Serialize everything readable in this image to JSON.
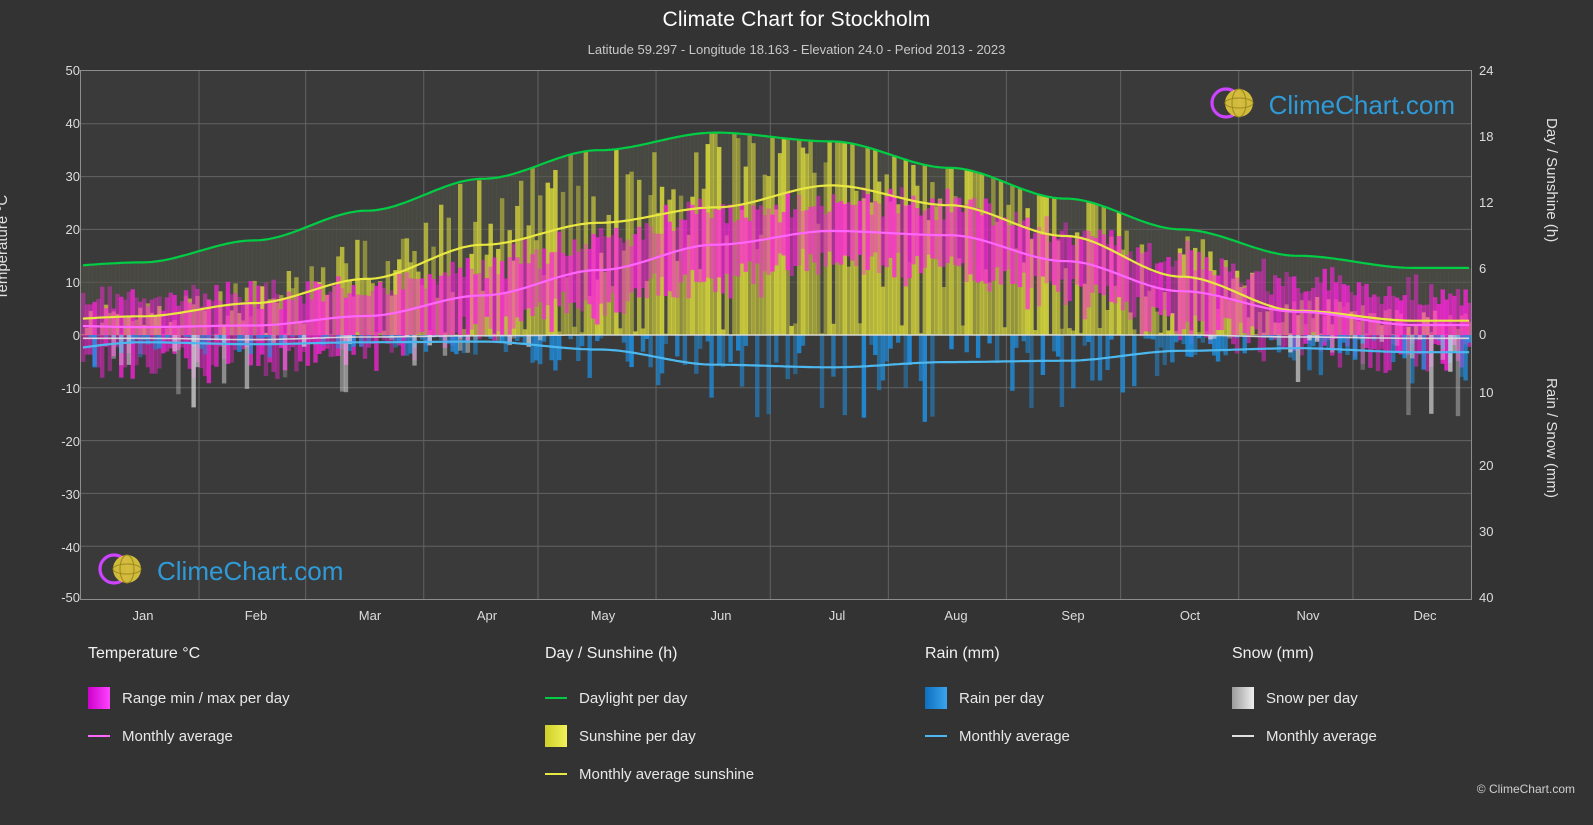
{
  "title": "Climate Chart for Stockholm",
  "subtitle": "Latitude 59.297 - Longitude 18.163 - Elevation 24.0 - Period 2013 - 2023",
  "axes": {
    "left_label": "Temperature °C",
    "right_label_top": "Day / Sunshine (h)",
    "right_label_bottom": "Rain / Snow (mm)",
    "left_ticks": [
      "50",
      "40",
      "30",
      "20",
      "10",
      "0",
      "-10",
      "-20",
      "-30",
      "-40",
      "-50"
    ],
    "right_ticks_top": [
      "24",
      "18",
      "12",
      "6",
      "0"
    ],
    "right_ticks_bottom": [
      "10",
      "20",
      "30",
      "40"
    ],
    "x_ticks": [
      "Jan",
      "Feb",
      "Mar",
      "Apr",
      "May",
      "Jun",
      "Jul",
      "Aug",
      "Sep",
      "Oct",
      "Nov",
      "Dec"
    ]
  },
  "legend": {
    "columns": [
      {
        "heading": "Temperature °C",
        "items": [
          {
            "label": "Range min / max per day",
            "type": "box",
            "color": "#ff00ff"
          },
          {
            "label": "Monthly average",
            "type": "line",
            "color": "#ff66ff"
          }
        ]
      },
      {
        "heading": "Day / Sunshine (h)",
        "items": [
          {
            "label": "Daylight per day",
            "type": "line",
            "color": "#00cc44"
          },
          {
            "label": "Sunshine per day",
            "type": "box",
            "color": "#e8e840"
          },
          {
            "label": "Monthly average sunshine",
            "type": "line",
            "color": "#e8e840"
          }
        ]
      },
      {
        "heading": "Rain (mm)",
        "items": [
          {
            "label": "Rain per day",
            "type": "box",
            "color": "#1f8fe0"
          },
          {
            "label": "Monthly average",
            "type": "line",
            "color": "#4db8f0"
          }
        ]
      },
      {
        "heading": "Snow (mm)",
        "items": [
          {
            "label": "Snow per day",
            "type": "box",
            "color": "#d8d8d8"
          },
          {
            "label": "Monthly average",
            "type": "line",
            "color": "#e0e0e0"
          }
        ]
      }
    ]
  },
  "copyright": "© ClimeChart.com",
  "watermark": {
    "brand_main": "Clime",
    "brand_rest": "Chart",
    "brand_tld": ".com"
  },
  "colors": {
    "background": "#333333",
    "plot_background": "#3a3a3a",
    "grid": "#6e6e6e",
    "daylight": "#00cc44",
    "sunshine": "#e8e840",
    "temp_range": "#ff00ff",
    "temp_avg": "#ff66ff",
    "rain": "#1f8fe0",
    "rain_avg": "#4db8f0",
    "snow": "#d8d8d8"
  },
  "chart_data": {
    "type": "line",
    "title": "Climate Chart for Stockholm",
    "subtitle": "Latitude 59.297 - Longitude 18.163 - Elevation 24.0 - Period 2013 - 2023",
    "xlabel": "",
    "ylabel": "Temperature °C",
    "ylim": [
      -50,
      50
    ],
    "y2lim_day": [
      0,
      24
    ],
    "y2lim_rain": [
      0,
      40
    ],
    "grid": true,
    "legend_position": "below",
    "categories": [
      "Jan",
      "Feb",
      "Mar",
      "Apr",
      "May",
      "Jun",
      "Jul",
      "Aug",
      "Sep",
      "Oct",
      "Nov",
      "Dec"
    ],
    "series": [
      {
        "name": "Daylight per day",
        "unit": "h",
        "axis": "right_day",
        "color": "#00cc44",
        "values": [
          6.6,
          8.6,
          11.3,
          14.2,
          16.8,
          18.4,
          17.6,
          15.2,
          12.4,
          9.6,
          7.2,
          6.1
        ]
      },
      {
        "name": "Monthly average sunshine",
        "unit": "h",
        "axis": "right_day",
        "color": "#e8e840",
        "values": [
          1.7,
          2.9,
          5.1,
          8.2,
          10.2,
          11.6,
          13.6,
          11.8,
          9.0,
          5.3,
          2.2,
          1.3
        ]
      },
      {
        "name": "Monthly average temperature",
        "unit": "°C",
        "axis": "left",
        "color": "#ff66ff",
        "values": [
          1.5,
          1.8,
          3.6,
          7.5,
          12.3,
          17.1,
          19.7,
          18.9,
          14.0,
          8.3,
          4.4,
          1.9
        ]
      },
      {
        "name": "Rain monthly average",
        "unit": "mm",
        "axis": "right_rain",
        "color": "#4db8f0",
        "values": [
          1.1,
          1.4,
          1.1,
          1.0,
          2.2,
          4.5,
          4.9,
          4.1,
          3.9,
          2.4,
          2.0,
          2.6
        ]
      },
      {
        "name": "Snow monthly average",
        "unit": "mm",
        "axis": "right_rain",
        "color": "#e0e0e0",
        "values": [
          0.5,
          0.7,
          0.3,
          0.1,
          0.0,
          0.0,
          0.0,
          0.0,
          0.0,
          0.0,
          0.3,
          0.5
        ]
      }
    ]
  }
}
